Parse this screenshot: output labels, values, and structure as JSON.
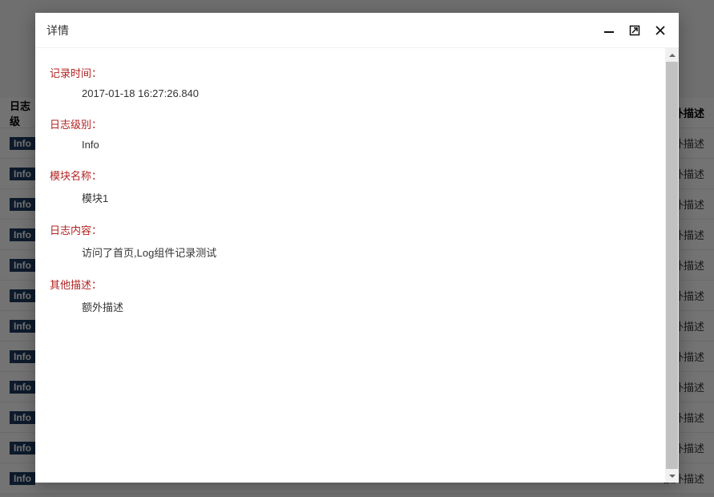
{
  "background": {
    "header_col_left": "日志级",
    "header_col_right": "额外描述",
    "row_badge": "Info",
    "row_right": "额外描述",
    "row_count": 12
  },
  "modal": {
    "title": "详情",
    "fields": [
      {
        "label": "记录时间：",
        "value": "2017-01-18 16:27:26.840"
      },
      {
        "label": "日志级别：",
        "value": "Info"
      },
      {
        "label": "模块名称：",
        "value": "模块1"
      },
      {
        "label": "日志内容：",
        "value": "访问了首页,Log组件记录测试"
      },
      {
        "label": "其他描述：",
        "value": "额外描述"
      }
    ]
  }
}
